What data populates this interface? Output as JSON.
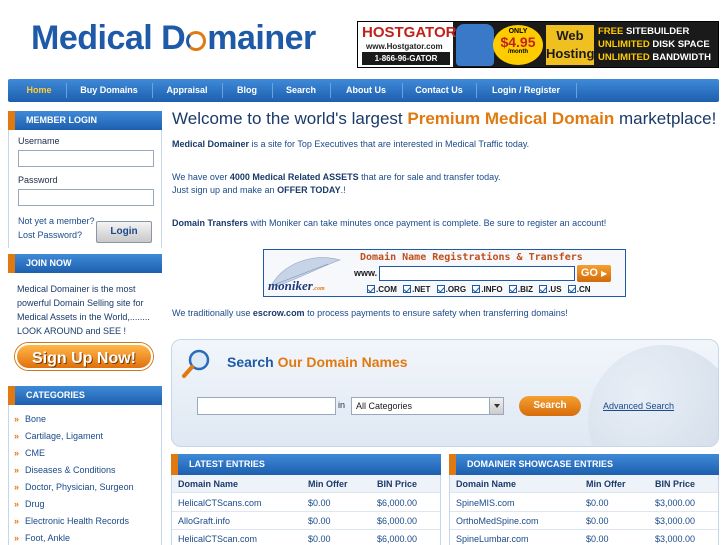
{
  "logo": {
    "part1": "Medical",
    "part2": "D",
    "part3": "mainer"
  },
  "ad": {
    "brand": "HOSTGATOR",
    "url": "www.Hostgator.com",
    "phone": "1-866-96-GATOR",
    "only": "ONLY",
    "price": "$4.95",
    "per": "/month",
    "web1": "Web",
    "web2": "Hosting",
    "feat1a": "FREE ",
    "feat1b": "SITEBUILDER",
    "feat2a": "UNLIMITED ",
    "feat2b": "DISK SPACE",
    "feat3a": "UNLIMITED ",
    "feat3b": "BANDWIDTH"
  },
  "nav": [
    {
      "label": "Home"
    },
    {
      "label": "Buy Domains"
    },
    {
      "label": "Appraisal"
    },
    {
      "label": "Blog"
    },
    {
      "label": "Search"
    },
    {
      "label": "About Us"
    },
    {
      "label": "Contact Us"
    },
    {
      "label": "Login / Register"
    }
  ],
  "sidebar": {
    "member_login": "MEMBER LOGIN",
    "username_label": "Username",
    "password_label": "Password",
    "not_member": "Not yet a member?",
    "lost_password": "Lost Password?",
    "login_btn": "Login",
    "join_now": "JOIN NOW",
    "join_text": "Medical Domainer is the most powerful Domain Selling site for Medical Assets in the World,........ LOOK AROUND and SEE !",
    "signup_btn": "Sign Up Now!",
    "categories_title": "CATEGORIES",
    "categories": [
      "Bone",
      "Cartilage, Ligament",
      "CME",
      "Diseases & Conditions",
      "Doctor, Physician, Surgeon",
      "Drug",
      "Electronic Health Records",
      "Foot, Ankle"
    ]
  },
  "main": {
    "title_a": "Welcome to the world's largest ",
    "title_hl": "Premium Medical Domain",
    "title_b": " marketplace!",
    "p1_b": "Medical Domainer",
    "p1": " is a site for Top Executives that are interested in Medical Traffic today.",
    "p2a": "We have over ",
    "p2_b": "4000 Medical Related ASSETS",
    "p2c": " that are for sale and transfer today.",
    "p3a": "Just sign up and make an ",
    "p3_b": "OFFER TODAY",
    "p3c": ".!",
    "p4_b": "Domain Transfers",
    "p4": " with Moniker can take minutes once payment is complete. Be sure to register an account!",
    "p5a": "We traditionally use ",
    "p5_b": "escrow.com",
    "p5c": " to process payments to ensure safety when transferring domains!"
  },
  "moniker": {
    "logo": "moniker",
    "logo_suffix": ".com",
    "title": "Domain Name Registrations & Transfers",
    "www": "www.",
    "go": "GO",
    "tlds": [
      ".COM",
      ".NET",
      ".ORG",
      ".INFO",
      ".BIZ",
      ".US",
      ".CN"
    ]
  },
  "search": {
    "title_a": "Search ",
    "title_hl": "Our Domain Names",
    "in": "in",
    "category_selected": "All Categories",
    "button": "Search",
    "advanced": "Advanced Search"
  },
  "latest": {
    "title": "LATEST ENTRIES",
    "headers": [
      "Domain Name",
      "Min Offer",
      "BIN Price"
    ],
    "rows": [
      [
        "HelicalCTScans.com",
        "$0.00",
        "$6,000.00"
      ],
      [
        "AlloGraft.info",
        "$0.00",
        "$6,000.00"
      ],
      [
        "HelicalCTScan.com",
        "$0.00",
        "$6,000.00"
      ]
    ]
  },
  "showcase": {
    "title": "DOMAINER SHOWCASE ENTRIES",
    "headers": [
      "Domain Name",
      "Min Offer",
      "BIN Price"
    ],
    "rows": [
      [
        "SpineMIS.com",
        "$0.00",
        "$3,000.00"
      ],
      [
        "OrthoMedSpine.com",
        "$0.00",
        "$3,000.00"
      ],
      [
        "SpineLumbar.com",
        "$0.00",
        "$3,000.00"
      ]
    ]
  }
}
